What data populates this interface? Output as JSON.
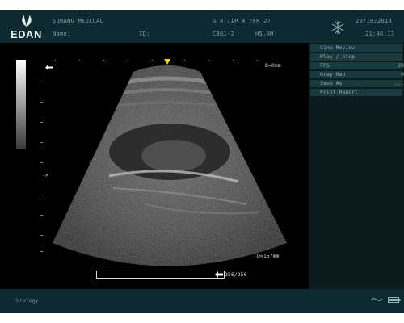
{
  "header": {
    "logo_text": "EDAN",
    "hospital": "SORANO MEDICAL",
    "name_label": "Name:",
    "id_label": "ID:",
    "params": "G  8 /IP 4 /FR 27",
    "probe": "C361-2",
    "freq": "H5.0M",
    "date": "20/10/2018",
    "time": "21:46:13"
  },
  "image": {
    "depth_top": "D=0mm",
    "depth_bottom": "D=157mm",
    "cine_frames": "256/256",
    "focus_marker": "->"
  },
  "menu": {
    "items": [
      {
        "label": "Cine Review",
        "value": ""
      },
      {
        "label": "Play / Stop",
        "value": ""
      },
      {
        "label": "FPS",
        "value": "20"
      },
      {
        "label": "Gray Map",
        "value": "0"
      },
      {
        "label": "Save As",
        "value": "..."
      },
      {
        "label": "Print Report",
        "value": ""
      }
    ]
  },
  "footer": {
    "exam": "Urology"
  },
  "colors": {
    "header_bg": "#0e2a30",
    "menu_item_bg": "#1b3a3f",
    "marker": "#f2d600"
  },
  "icons": [
    "edan-logo-icon",
    "freeze-snowflake-icon",
    "orientation-marker-icon",
    "connection-wave-icon",
    "battery-icon"
  ]
}
